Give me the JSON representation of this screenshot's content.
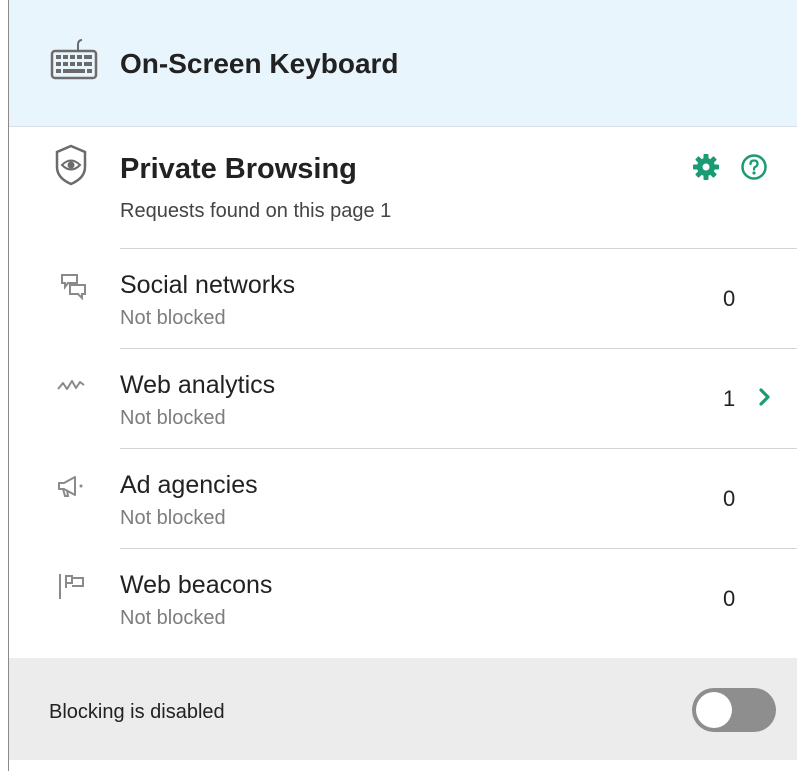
{
  "header": {
    "title": "On-Screen Keyboard",
    "icon": "keyboard-icon"
  },
  "private_browsing": {
    "title": "Private Browsing",
    "subtitle": "Requests found on this page 1",
    "icon": "shield-eye-icon",
    "settings_icon": "gear-icon",
    "help_icon": "help-icon",
    "accent_color": "#1a9b74"
  },
  "categories": [
    {
      "label": "Social networks",
      "status": "Not blocked",
      "count": "0",
      "icon": "chat-bubbles-icon",
      "has_details": false
    },
    {
      "label": "Web analytics",
      "status": "Not blocked",
      "count": "1",
      "icon": "analytics-wave-icon",
      "has_details": true
    },
    {
      "label": "Ad agencies",
      "status": "Not blocked",
      "count": "0",
      "icon": "megaphone-icon",
      "has_details": false
    },
    {
      "label": "Web beacons",
      "status": "Not blocked",
      "count": "0",
      "icon": "flag-icon",
      "has_details": false
    }
  ],
  "footer": {
    "label": "Blocking is disabled",
    "toggle_on": false,
    "toggle_color_off": "#8e8e8e"
  }
}
